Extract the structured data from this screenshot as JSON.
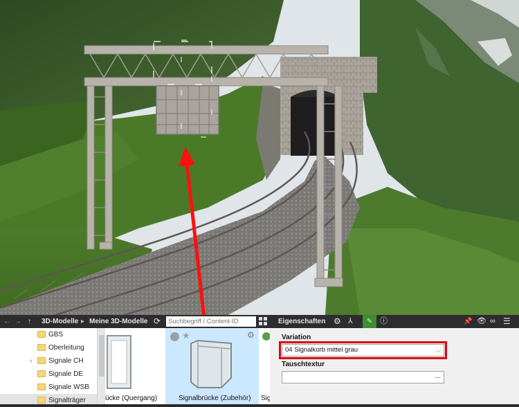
{
  "toolbar": {
    "breadcrumb_root": "3D-Modelle",
    "breadcrumb_sep": "▸",
    "breadcrumb_child": "Meine 3D-Modelle",
    "search_placeholder": "Suchbegriff / Content-ID",
    "properties_title": "Eigenschaften"
  },
  "tree": {
    "items": [
      {
        "label": "GBS",
        "expandable": false,
        "selected": false
      },
      {
        "label": "Oberleitung",
        "expandable": false,
        "selected": false
      },
      {
        "label": "Signale CH",
        "expandable": true,
        "selected": false
      },
      {
        "label": "Signale DE",
        "expandable": false,
        "selected": false
      },
      {
        "label": "Signale WSB",
        "expandable": false,
        "selected": false
      },
      {
        "label": "Signalträger",
        "expandable": false,
        "selected": true
      }
    ]
  },
  "models": {
    "cards": [
      {
        "caption": "ücke (Quergang)",
        "selected": false
      },
      {
        "caption": "Signalbrücke (Zubehör)",
        "selected": true
      },
      {
        "caption": "Sig",
        "selected": false
      }
    ]
  },
  "properties": {
    "variation_label": "Variation",
    "variation_value": "04 Signalkorb mittel grau",
    "swap_texture_label": "Tauschtextur",
    "swap_texture_button": "..."
  },
  "colors": {
    "highlight": "#e00012",
    "arrow": "#ff1010",
    "selected_card": "#cce8ff",
    "active_tab": "#3c8d2f"
  }
}
